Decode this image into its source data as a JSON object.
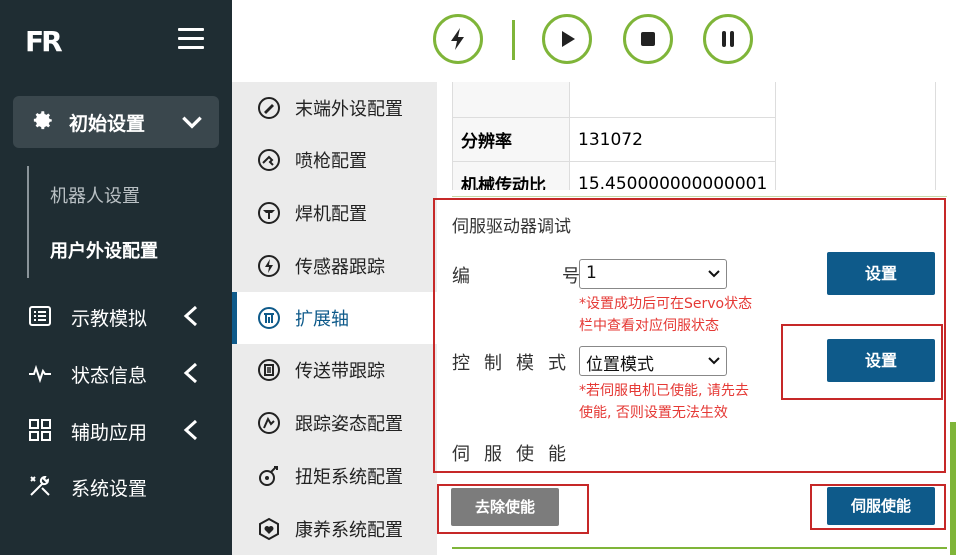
{
  "app": {
    "logo": "FR"
  },
  "sidebar": {
    "init_settings_label": "初始设置",
    "sub_items": [
      "机器人设置",
      "用户外设配置"
    ],
    "nav": [
      {
        "label": "示教模拟",
        "icon": "list-icon"
      },
      {
        "label": "状态信息",
        "icon": "pulse-icon"
      },
      {
        "label": "辅助应用",
        "icon": "grid-icon"
      },
      {
        "label": "系统设置",
        "icon": "tools-icon"
      }
    ]
  },
  "topbar": {
    "buttons": [
      "lightning-icon",
      "play-icon",
      "stop-icon",
      "pause-icon"
    ],
    "accent": "#7fb539"
  },
  "submenu": {
    "items": [
      {
        "label": "末端外设配置",
        "icon": "end-effector-icon"
      },
      {
        "label": "喷枪配置",
        "icon": "spray-gun-icon"
      },
      {
        "label": "焊机配置",
        "icon": "welder-icon"
      },
      {
        "label": "传感器跟踪",
        "icon": "sensor-icon"
      },
      {
        "label": "扩展轴",
        "icon": "extension-axis-icon"
      },
      {
        "label": "传送带跟踪",
        "icon": "conveyor-icon"
      },
      {
        "label": "跟踪姿态配置",
        "icon": "posture-icon"
      },
      {
        "label": "扭矩系统配置",
        "icon": "torque-icon"
      },
      {
        "label": "康养系统配置",
        "icon": "care-icon"
      }
    ],
    "active_index": 4
  },
  "table": {
    "rows": [
      {
        "key": "分辨率",
        "value": "131072"
      },
      {
        "key": "机械传动比",
        "value": "15.450000000000001"
      }
    ]
  },
  "servo": {
    "title": "伺服驱动器调试",
    "id_label": "编号",
    "id_value": "1",
    "hint1_line1": "*设置成功后可在Servo状态",
    "hint1_line2": "栏中查看对应伺服状态",
    "mode_label": "控制模式",
    "mode_value": "位置模式",
    "hint2_line1": "*若伺服电机已使能, 请先去",
    "hint2_line2": "使能, 否则设置无法生效",
    "enable_label": "伺服使能",
    "set_button": "设置",
    "set_button2": "设置",
    "disable_button": "去除使能",
    "enable_button": "伺服使能"
  },
  "colors": {
    "brand_blue": "#0e5a8a",
    "sidebar_bg": "#1f2d33",
    "highlight_red": "#c62828",
    "hint_red": "#e53935"
  }
}
